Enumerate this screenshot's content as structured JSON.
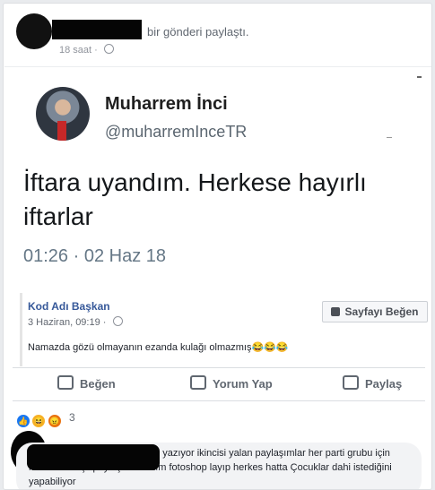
{
  "header": {
    "shared_text": "bir gönderi paylaştı.",
    "time": "18 saat"
  },
  "tweet": {
    "name": "Muharrem İnci",
    "handle": "@muharremInceTR",
    "text": "İftara uyandım. Herkese hayırlı iftarlar",
    "datetime": "01:26 · 02 Haz 18"
  },
  "shared_post": {
    "page_name": "Kod Adı Başkan",
    "time": "3 Haziran, 09:19",
    "like_page_label": "Sayfayı Beğen",
    "body": "Namazda gözü olmayanın ezanda kulağı olmazmış😂😂😂"
  },
  "actions": {
    "like": "Beğen",
    "comment": "Yorum Yap",
    "share": "Paylaş"
  },
  "reactions": {
    "count": "3"
  },
  "comment": {
    "text": "r Hesap sahte zatenorada inci yazıyor ikincisi yalan paylaşımlar her parti grubu için mevcut bilinçli paylaşmak lazım fotoshop layıp herkes hatta Çocuklar dahi istediğini yapabiliyor"
  },
  "icons": [
    "globe-icon",
    "thumbs-up-icon",
    "comment-icon",
    "share-icon",
    "like-reaction-icon",
    "haha-reaction-icon",
    "angry-reaction-icon"
  ],
  "colors": {
    "link": "#365899",
    "text_secondary": "#616770",
    "like_reaction": "#1877f2"
  }
}
